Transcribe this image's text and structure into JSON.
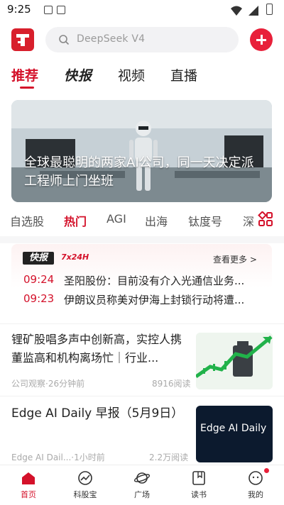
{
  "status_bar": {
    "time": "9:25"
  },
  "header": {
    "search_placeholder": "DeepSeek V4",
    "logo_icon": "toutiao-t-logo",
    "add_icon": "plus-icon"
  },
  "main_tabs": [
    {
      "label": "推荐",
      "active": true
    },
    {
      "label": "快报"
    },
    {
      "label": "视频"
    },
    {
      "label": "直播"
    }
  ],
  "banner": {
    "title": "全球最聪明的两家AI公司，同一天决定派工程师上门坐班"
  },
  "category_tabs": [
    {
      "label": "自选股"
    },
    {
      "label": "热门",
      "active": true
    },
    {
      "label": "AGI"
    },
    {
      "label": "出海"
    },
    {
      "label": "钛度号"
    },
    {
      "label": "深"
    }
  ],
  "flash": {
    "logo": "快报",
    "tag": "7x24H",
    "more": "查看更多 >",
    "items": [
      {
        "time": "09:24",
        "text": "圣阳股份：目前没有介入光通信业务..."
      },
      {
        "time": "09:23",
        "text": "伊朗议员称美对伊海上封锁行动将遭..."
      }
    ]
  },
  "articles": [
    {
      "title": "锂矿股唱多声中创新高，实控人携董监高和机构离场忙｜行业...",
      "source": "公司观察·26分钟前",
      "reads": "8916阅读"
    },
    {
      "title": "Edge AI Daily 早报（5月9日）",
      "source": "Edge AI Dail...·1小时前",
      "reads": "2.2万阅读",
      "image_text": "Edge AI Daily"
    }
  ],
  "bottom_nav": [
    {
      "label": "首页",
      "icon": "home-icon",
      "active": true
    },
    {
      "label": "科股宝",
      "icon": "chart-circle-icon"
    },
    {
      "label": "广场",
      "icon": "planet-icon"
    },
    {
      "label": "读书",
      "icon": "book-icon"
    },
    {
      "label": "我的",
      "icon": "profile-face-icon"
    }
  ],
  "colors": {
    "accent": "#d4112a",
    "brand": "#d81f2c"
  }
}
